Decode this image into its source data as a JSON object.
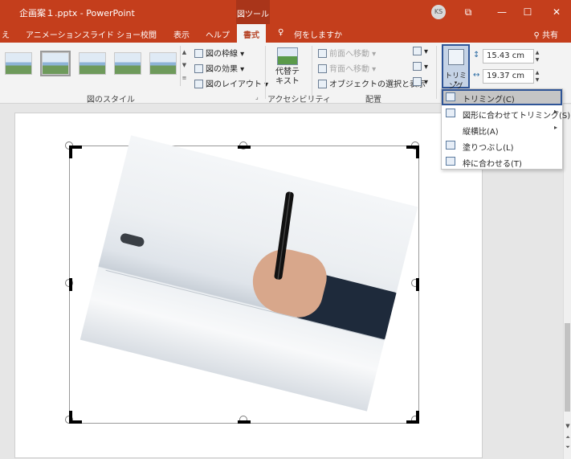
{
  "titlebar": {
    "title": "企画案１.pptx  -  PowerPoint",
    "context_tab": "図ツール",
    "avatar": "KS",
    "minimize": "—",
    "maximize": "☐",
    "close": "✕",
    "ribbon_display": "⧉"
  },
  "tabs": {
    "partial_left": "え",
    "animation": "アニメーション",
    "slideshow": "スライド ショー",
    "review": "校閲",
    "view": "表示",
    "help": "ヘルプ",
    "format": "書式",
    "tellme": "何をしますか",
    "share": "共有"
  },
  "ribbon": {
    "picture_border": "図の枠線",
    "picture_effects": "図の効果",
    "picture_layout": "図のレイアウト",
    "alt_text": "代替テキスト",
    "bring_forward": "前面へ移動",
    "send_backward": "背面へ移動",
    "selection_pane": "オブジェクトの選択と表示",
    "crop": "トリミング",
    "height": "15.43 cm",
    "width": "19.37 cm",
    "group_picture_styles": "図のスタイル",
    "group_accessibility": "アクセシビリティ",
    "group_arrange": "配置"
  },
  "crop_menu": {
    "items": [
      {
        "label": "トリミング(C)"
      },
      {
        "label": "図形に合わせてトリミング(S)"
      },
      {
        "label": "縦横比(A)"
      },
      {
        "label": "塗りつぶし(L)"
      },
      {
        "label": "枠に合わせる(T)"
      }
    ]
  },
  "colors": {
    "accent": "#c43e1c",
    "highlight_border": "#2f5597"
  }
}
